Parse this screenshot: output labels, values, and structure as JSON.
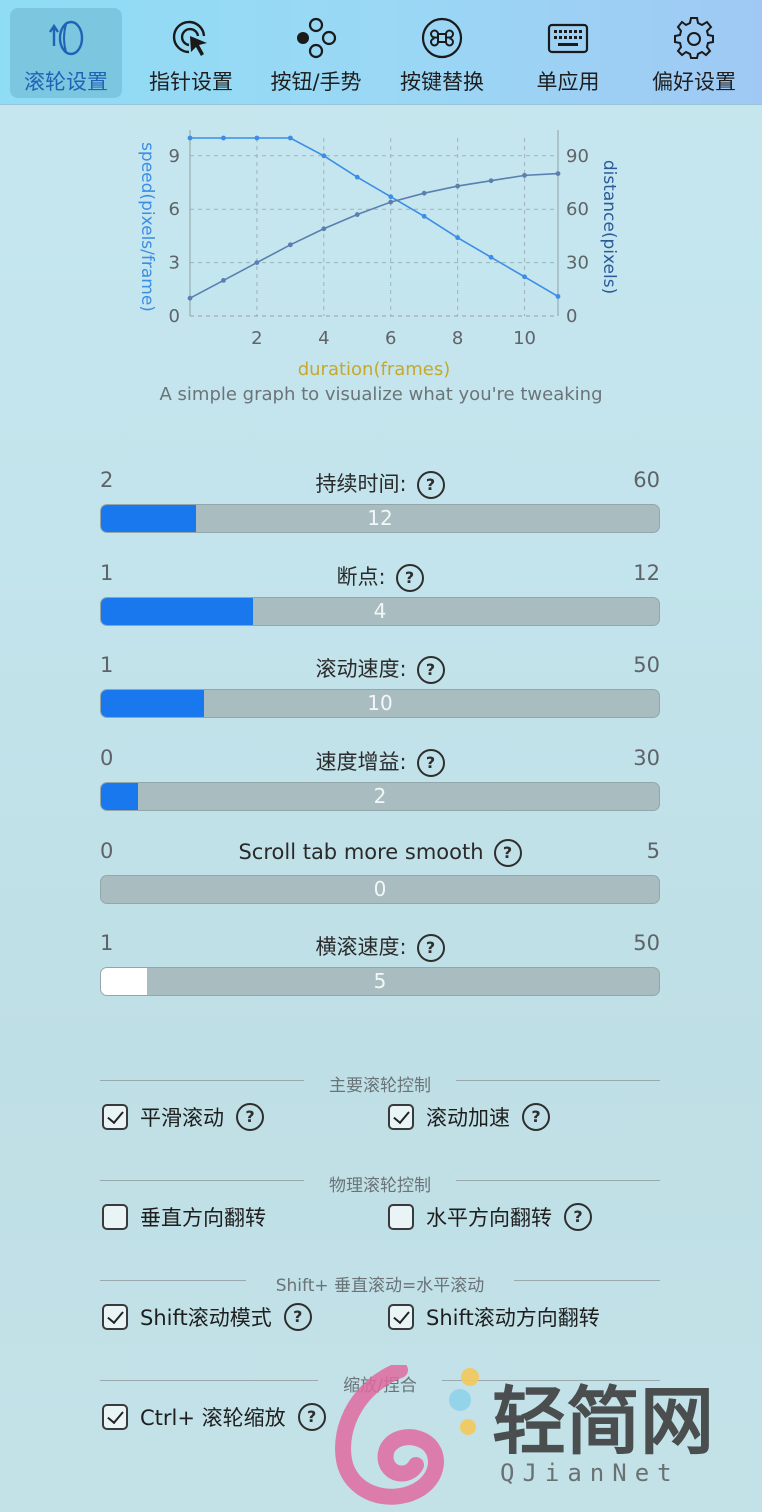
{
  "toolbar": {
    "items": [
      {
        "label": "滚轮设置",
        "icon": "scroll-wheel-icon",
        "active": true
      },
      {
        "label": "指针设置",
        "icon": "pointer-icon",
        "active": false
      },
      {
        "label": "按钮/手势",
        "icon": "buttons-gesture-icon",
        "active": false
      },
      {
        "label": "按键替换",
        "icon": "command-key-icon",
        "active": false
      },
      {
        "label": "单应用",
        "icon": "keyboard-icon",
        "active": false
      },
      {
        "label": "偏好设置",
        "icon": "gear-icon",
        "active": false
      }
    ]
  },
  "graph": {
    "left_axis_label": "speed(pixels/frame)",
    "right_axis_label": "distance(pixels)",
    "x_axis_label": "duration(frames)",
    "caption": "A simple graph to visualize what you're tweaking"
  },
  "chart_data": {
    "type": "line",
    "xlabel": "duration(frames)",
    "ylabel": "speed(pixels/frame)",
    "y2label": "distance(pixels)",
    "xlim": [
      0,
      11
    ],
    "ylim": [
      0,
      10
    ],
    "y2lim": [
      0,
      100
    ],
    "x_ticks": [
      2,
      4,
      6,
      8,
      10
    ],
    "y_ticks": [
      0,
      3,
      6,
      9
    ],
    "y2_ticks": [
      0,
      30,
      60,
      90
    ],
    "grid": true,
    "series": [
      {
        "axis": "left",
        "color": "#3c8de6",
        "x": [
          0,
          1,
          2,
          3,
          4,
          5,
          6,
          7,
          8,
          9,
          10,
          11
        ],
        "values": [
          10,
          10,
          10,
          10,
          9,
          7.8,
          6.7,
          5.6,
          4.4,
          3.3,
          2.2,
          1.1
        ]
      },
      {
        "axis": "right",
        "color": "#5a7fb0",
        "x": [
          0,
          1,
          2,
          3,
          4,
          5,
          6,
          7,
          8,
          9,
          10,
          11
        ],
        "values": [
          10,
          20,
          30,
          40,
          49,
          57,
          64,
          69,
          73,
          76,
          79,
          80
        ]
      }
    ]
  },
  "sliders": [
    {
      "title": "持续时间:",
      "min": "2",
      "max": "60",
      "value": "12",
      "fraction": 0.17,
      "style": "blue"
    },
    {
      "title": "断点:",
      "min": "1",
      "max": "12",
      "value": "4",
      "fraction": 0.273,
      "style": "blue"
    },
    {
      "title": "滚动速度:",
      "min": "1",
      "max": "50",
      "value": "10",
      "fraction": 0.184,
      "style": "blue"
    },
    {
      "title": "速度增益:",
      "min": "0",
      "max": "30",
      "value": "2",
      "fraction": 0.067,
      "style": "blue"
    },
    {
      "title": "Scroll tab more smooth",
      "min": "0",
      "max": "5",
      "value": "0",
      "fraction": 0,
      "style": "blue"
    },
    {
      "title": "横滚速度:",
      "min": "1",
      "max": "50",
      "value": "5",
      "fraction": 0.082,
      "style": "white"
    }
  ],
  "sections": {
    "main_wheel": "主要滚轮控制",
    "physical_wheel": "物理滚轮控制",
    "shift_scroll": "Shift+ 垂直滚动=水平滚动",
    "zoom": "缩放/捏合"
  },
  "checkboxes": {
    "smooth_scroll": {
      "label": "平滑滚动",
      "checked": true
    },
    "scroll_accel": {
      "label": "滚动加速",
      "checked": true
    },
    "reverse_vertical": {
      "label": "垂直方向翻转",
      "checked": false
    },
    "reverse_horizontal": {
      "label": "水平方向翻转",
      "checked": false
    },
    "shift_mode": {
      "label": "Shift滚动模式",
      "checked": true
    },
    "shift_reverse": {
      "label": "Shift滚动方向翻转",
      "checked": true
    },
    "ctrl_zoom": {
      "label": "Ctrl+ 滚轮缩放",
      "checked": true
    }
  },
  "help_glyph": "?",
  "watermark": {
    "title": "轻简网",
    "subtitle": "QJianNet"
  }
}
